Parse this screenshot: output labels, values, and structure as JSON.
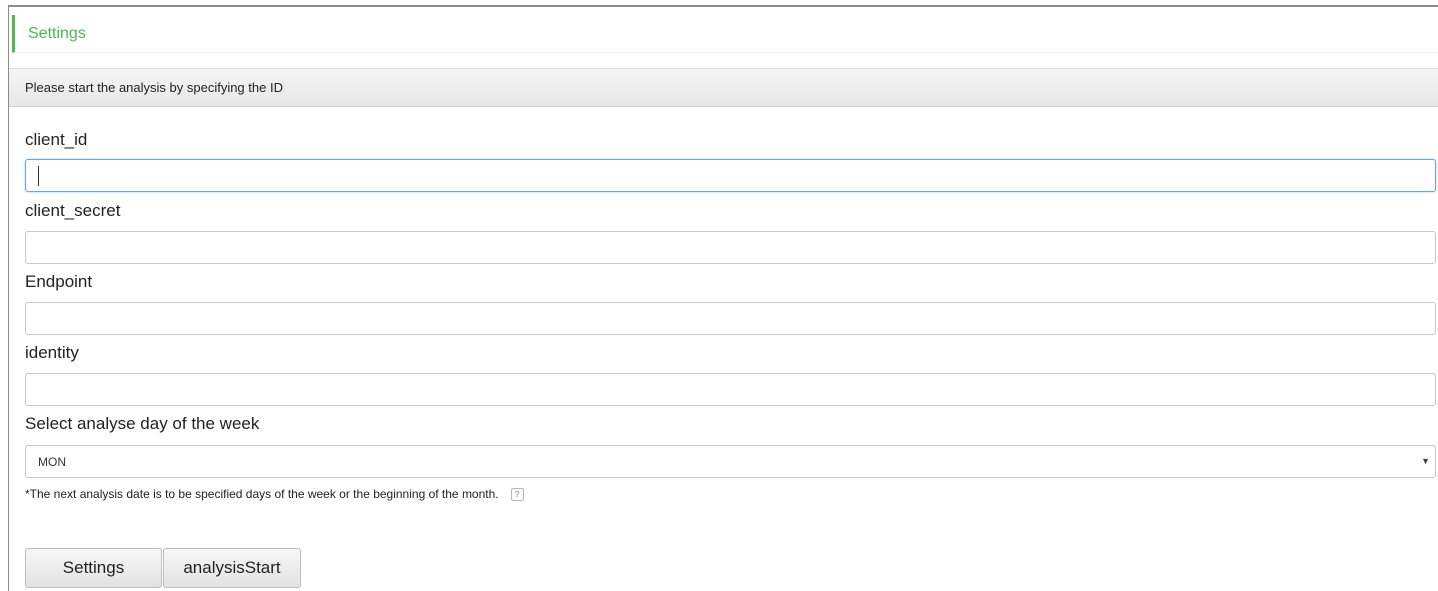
{
  "header": {
    "title": "Settings"
  },
  "instruction": "Please start the analysis by specifying the ID",
  "fields": {
    "client_id": {
      "label": "client_id",
      "value": ""
    },
    "client_secret": {
      "label": "client_secret",
      "value": ""
    },
    "endpoint": {
      "label": "Endpoint",
      "value": ""
    },
    "identity": {
      "label": "identity",
      "value": ""
    }
  },
  "day_select": {
    "label": "Select analyse day of the week",
    "selected": "MON"
  },
  "note": {
    "text": "*The next analysis date is to be specified days of the week or the beginning of the month.",
    "help_glyph": "?"
  },
  "buttons": {
    "settings": "Settings",
    "analysis_start": "analysisStart"
  },
  "colors": {
    "accent_green": "#4cb850",
    "focus_blue": "#6aa7d6"
  }
}
